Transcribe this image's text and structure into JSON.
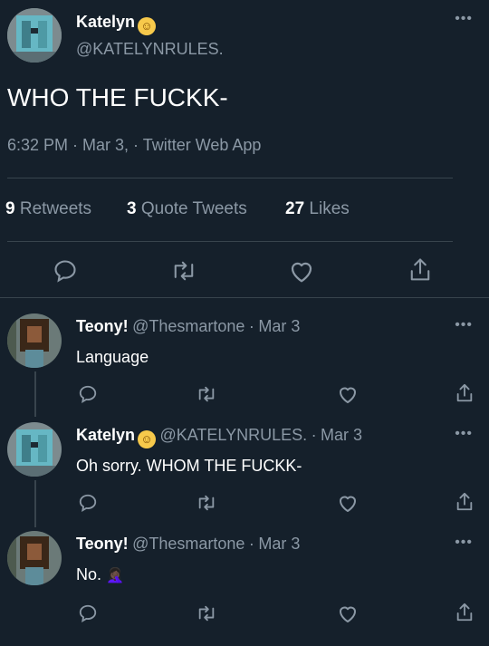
{
  "main_tweet": {
    "author_name": "Katelyn",
    "author_emoji": "☺",
    "author_handle": "@KATELYNRULES.",
    "text": "WHO THE FUCKK-",
    "meta": "6:32 PM · Mar 3, · Twitter Web App",
    "stats": [
      {
        "num": "9",
        "label": "Retweets"
      },
      {
        "num": "3",
        "label": "Quote Tweets"
      },
      {
        "num": "27",
        "label": "Likes"
      }
    ],
    "more": "•••"
  },
  "replies": [
    {
      "name": "Teony!",
      "handle": "@Thesmartone",
      "sep": "·",
      "date": "Mar 3",
      "text": "Language",
      "emoji": "",
      "more": "•••"
    },
    {
      "name": "Katelyn",
      "handle": "@KATELYNRULES.",
      "sep": "·",
      "date": "Mar 3",
      "text": "Oh sorry. WHOM THE FUCKK-",
      "emoji": "☺",
      "more": "•••"
    },
    {
      "name": "Teony!",
      "handle": "@Thesmartone",
      "sep": "·",
      "date": "Mar 3",
      "text": "No.",
      "emoji": "🤦🏿‍♀️",
      "more": "•••"
    }
  ],
  "colors": {
    "background": "#15202b",
    "muted": "#8b98a5",
    "divider": "#38444d"
  },
  "icons": [
    "reply-icon",
    "retweet-icon",
    "like-icon",
    "share-icon",
    "more-icon"
  ]
}
